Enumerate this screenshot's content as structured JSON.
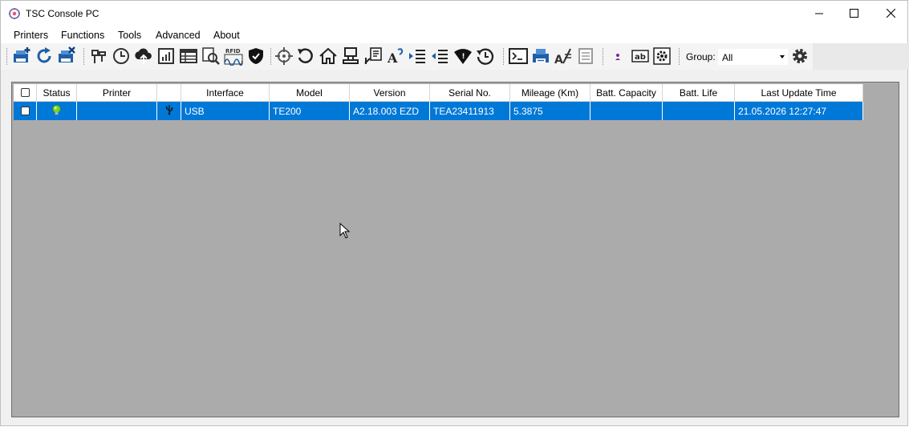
{
  "window": {
    "title": "TSC Console PC"
  },
  "menu": [
    "Printers",
    "Functions",
    "Tools",
    "Advanced",
    "About"
  ],
  "toolbar": {
    "group_label": "Group:",
    "group_value": "All",
    "icons": [
      "add-printer-icon",
      "refresh-icon",
      "remove-printer-icon",
      "printer-settings-icon",
      "clock-icon",
      "cloud-upload-icon",
      "statistics-icon",
      "table-icon",
      "inspect-icon",
      "rfid-icon",
      "security-shield-icon",
      "calibrate-target-icon",
      "undo-icon",
      "home-icon",
      "stamp-icon",
      "signature-icon",
      "font-icon",
      "indent-left-icon",
      "indent-right-icon",
      "wifi-icon",
      "history-icon",
      "terminal-icon",
      "print-job-icon",
      "font-size-icon",
      "document-icon",
      "user-icon",
      "label-ab-icon",
      "config-gear-icon",
      "settings-gear-icon"
    ]
  },
  "grid": {
    "columns": [
      "",
      "Status",
      "Printer",
      "",
      "Interface",
      "Model",
      "Version",
      "Serial No.",
      "Mileage (Km)",
      "Batt. Capacity",
      "Batt. Life",
      "Last Update Time"
    ],
    "rows": [
      {
        "status": "online",
        "printer": "",
        "interface_icon": "usb-icon",
        "interface": "USB",
        "model": "TE200",
        "version": "A2.18.003 EZD",
        "serial": "TEA23411913",
        "mileage": "5.3875",
        "batt_capacity": "",
        "batt_life": "",
        "last_update": "21.05.2026 12:27:47"
      }
    ]
  },
  "colors": {
    "selection": "#0078d7",
    "grid_bg": "#ababab",
    "status_on": "#7ed321"
  }
}
